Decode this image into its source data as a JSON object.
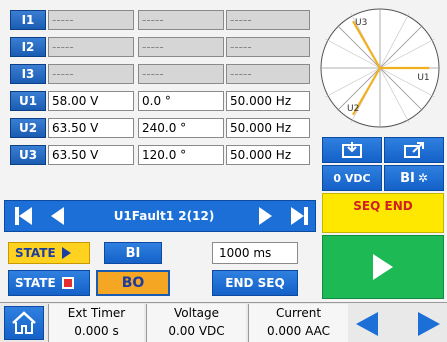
{
  "measurements": [
    {
      "label": "I1",
      "magnitude": "-----",
      "angle": "-----",
      "frequency": "-----",
      "active": false
    },
    {
      "label": "I2",
      "magnitude": "-----",
      "angle": "-----",
      "frequency": "-----",
      "active": false
    },
    {
      "label": "I3",
      "magnitude": "-----",
      "angle": "-----",
      "frequency": "-----",
      "active": false
    },
    {
      "label": "U1",
      "magnitude": "58.00 V",
      "angle": "0.0 °",
      "frequency": "50.000 Hz",
      "active": true
    },
    {
      "label": "U2",
      "magnitude": "63.50 V",
      "angle": "240.0 °",
      "frequency": "50.000 Hz",
      "active": true
    },
    {
      "label": "U3",
      "magnitude": "63.50 V",
      "angle": "120.0 °",
      "frequency": "50.000 Hz",
      "active": true
    }
  ],
  "vector_diagram": {
    "vectors": [
      {
        "label": "U1",
        "angle_deg": 0,
        "magnitude": 58.0
      },
      {
        "label": "U2",
        "angle_deg": 240,
        "magnitude": 63.5
      },
      {
        "label": "U3",
        "angle_deg": 120,
        "magnitude": 63.5
      }
    ],
    "color": "#f0b020"
  },
  "right_buttons": {
    "dc_label": "0 VDC",
    "bi_label": "BI",
    "seq_end_label": "SEQ END"
  },
  "nav": {
    "state_name": "U1Fault1 2(12)"
  },
  "controls": {
    "state_label": "STATE",
    "bi_label": "BI",
    "bo_label": "BO",
    "time_value": "1000 ms",
    "end_seq_label": "END SEQ"
  },
  "status": {
    "ext_timer_label": "Ext Timer",
    "ext_timer_value": "0.000 s",
    "voltage_label": "Voltage",
    "voltage_value": "0.00 VDC",
    "current_label": "Current",
    "current_value": "0.000 AAC"
  },
  "colors": {
    "accent_blue": "#1b6fd6",
    "yellow": "#ffe800",
    "orange": "#f5a623",
    "green": "#1db954",
    "red": "#e53030"
  }
}
